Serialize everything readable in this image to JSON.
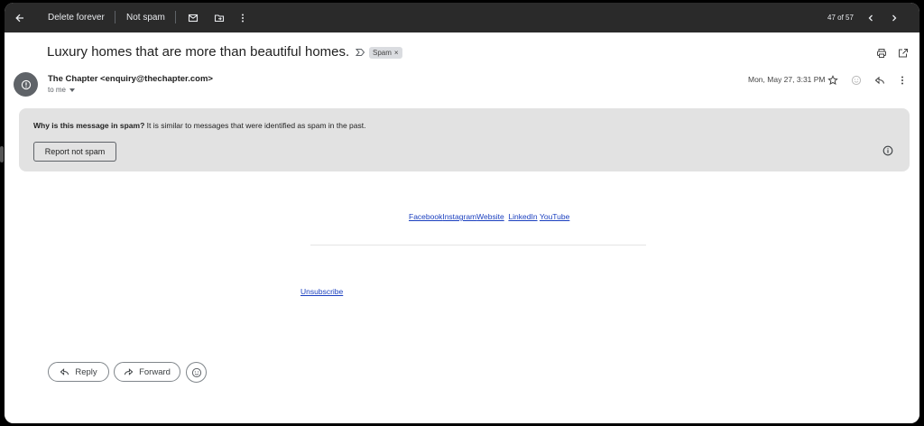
{
  "toolbar": {
    "back_icon": "arrow-left-icon",
    "delete_forever_label": "Delete forever",
    "not_spam_label": "Not spam",
    "mark_unread_icon": "mark-unread-icon",
    "move_to_icon": "move-to-folder-icon",
    "more_icon": "more-vertical-icon",
    "pagination": "47 of 57",
    "newer_icon": "chevron-left-icon",
    "older_icon": "chevron-right-icon"
  },
  "message": {
    "subject": "Luxury homes that are more than beautiful homes.",
    "label": "Spam",
    "label_remove": "×",
    "sender": "The Chapter <enquiry@thechapter.com>",
    "recipient": "to me",
    "date": "Mon, May 27, 3:31 PM"
  },
  "spam_banner": {
    "question": "Why is this message in spam?",
    "reason": " It is similar to messages that were identified as spam in the past.",
    "report_button": "Report not spam"
  },
  "body": {
    "links": [
      "Facebook",
      "Instagram",
      "Website",
      "LinkedIn",
      "YouTube"
    ],
    "unsubscribe": "Unsubscribe"
  },
  "actions": {
    "reply_label": "Reply",
    "forward_label": "Forward"
  },
  "colors": {
    "toolbar_bg": "#2a2a2a",
    "banner_bg": "#e2e2e2",
    "link": "#1a3fbf"
  }
}
